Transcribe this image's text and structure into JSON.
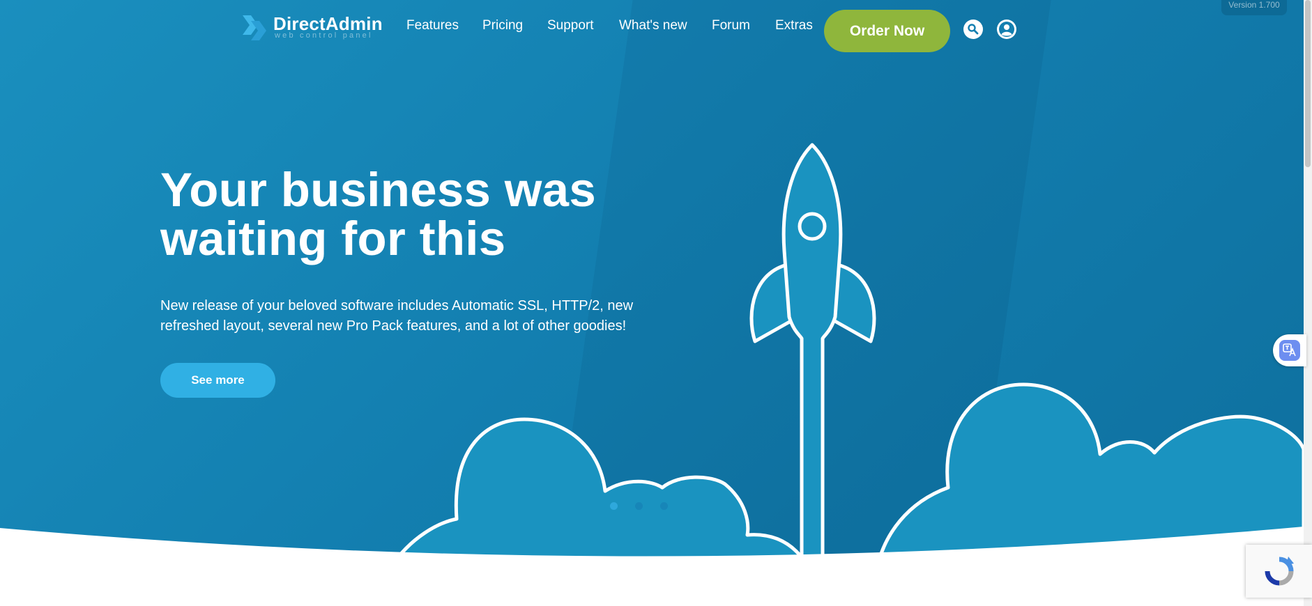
{
  "brand": {
    "name": "DirectAdmin",
    "tagline": "web control panel"
  },
  "nav": {
    "items": [
      "Features",
      "Pricing",
      "Support",
      "What's new",
      "Forum",
      "Extras"
    ],
    "order_label": "Order Now",
    "icons": [
      "search-icon",
      "user-account-icon"
    ]
  },
  "version": "Version 1.700",
  "hero": {
    "headline_line1": "Your business was",
    "headline_line2": "waiting for this",
    "subtext": "New release of your beloved software includes Automatic SSL, HTTP/2, new refreshed layout, several new Pro Pack features, and a lot of other goodies!",
    "cta_label": "See more",
    "slides": {
      "count": 3,
      "active": 1
    }
  },
  "colors": {
    "hero_bg": "#137fb0",
    "cloud_fill": "#1a93c0",
    "order_button": "#8fb63c",
    "cta_button": "#30b0e4"
  },
  "widgets": [
    "translate-icon",
    "recaptcha-badge"
  ]
}
